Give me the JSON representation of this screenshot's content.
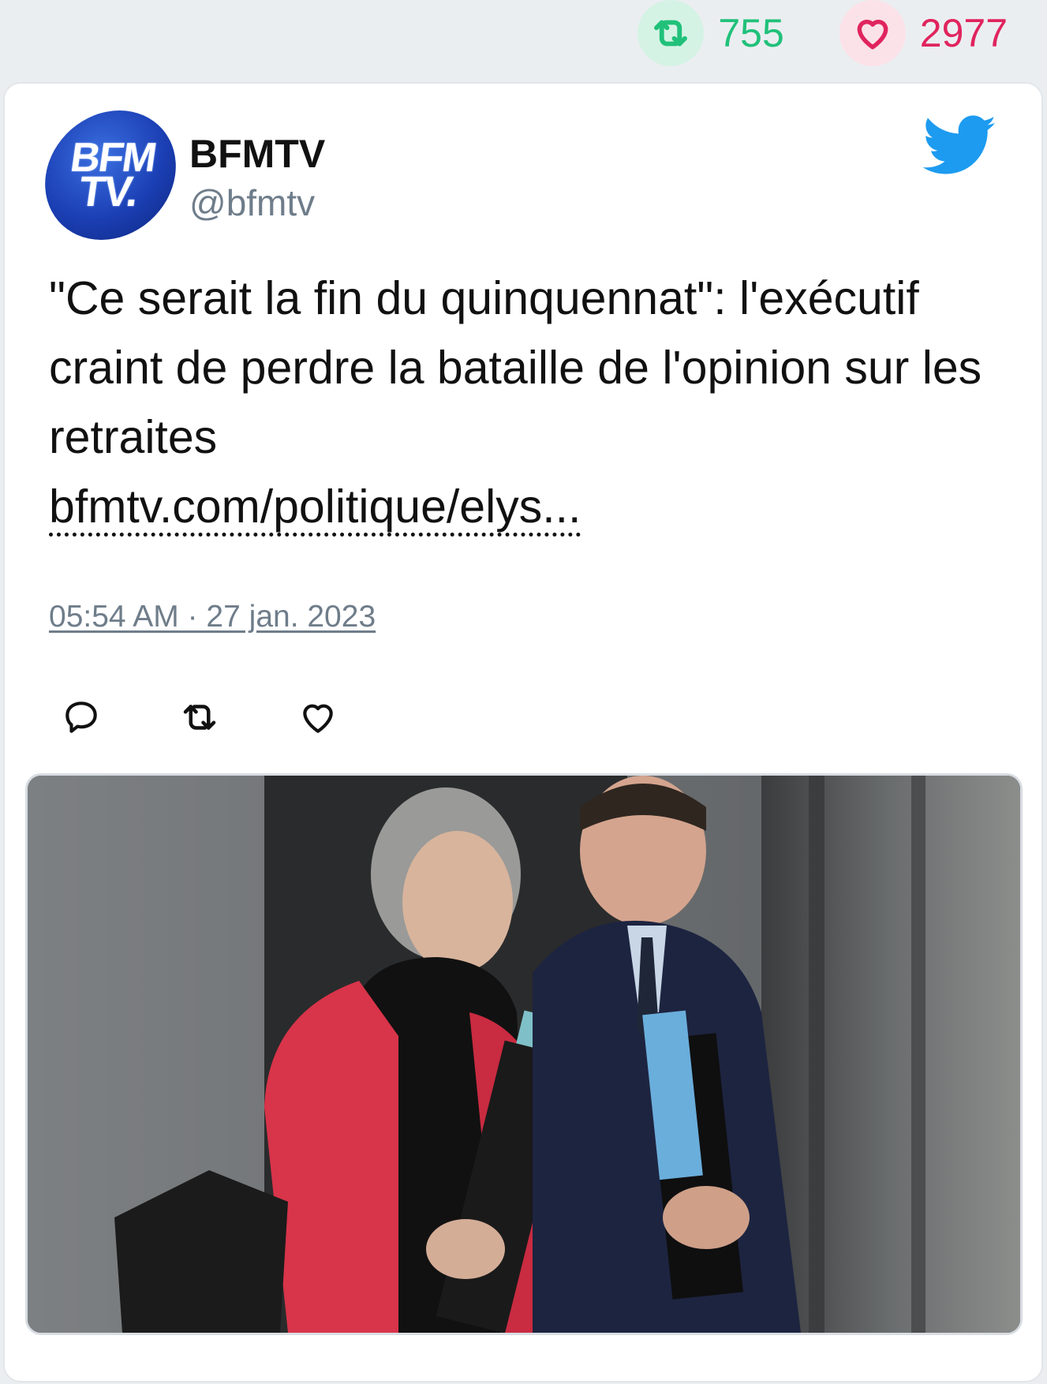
{
  "stats": {
    "retweets": "755",
    "likes": "2977",
    "retweet_icon": "retweet-icon",
    "like_icon": "heart-icon",
    "retweet_color": "#21c17a",
    "like_color": "#e0245e"
  },
  "tweet": {
    "avatar_text_line1": "BFM",
    "avatar_text_line2": "TV.",
    "display_name": "BFMTV",
    "handle": "@bfmtv",
    "text": "\"Ce serait la fin du quinquennat\": l'exécutif craint de perdre la bataille de l'opinion sur les retraites",
    "link": "bfmtv.com/politique/elys...",
    "timestamp": "05:54 AM · 27 jan. 2023",
    "brand_icon": "twitter-bird-icon",
    "brand_color": "#1d9bf0"
  },
  "actions": [
    {
      "name": "reply",
      "icon": "reply-icon"
    },
    {
      "name": "retweet",
      "icon": "retweet-icon"
    },
    {
      "name": "like",
      "icon": "heart-icon"
    }
  ],
  "media": {
    "type": "photo"
  }
}
